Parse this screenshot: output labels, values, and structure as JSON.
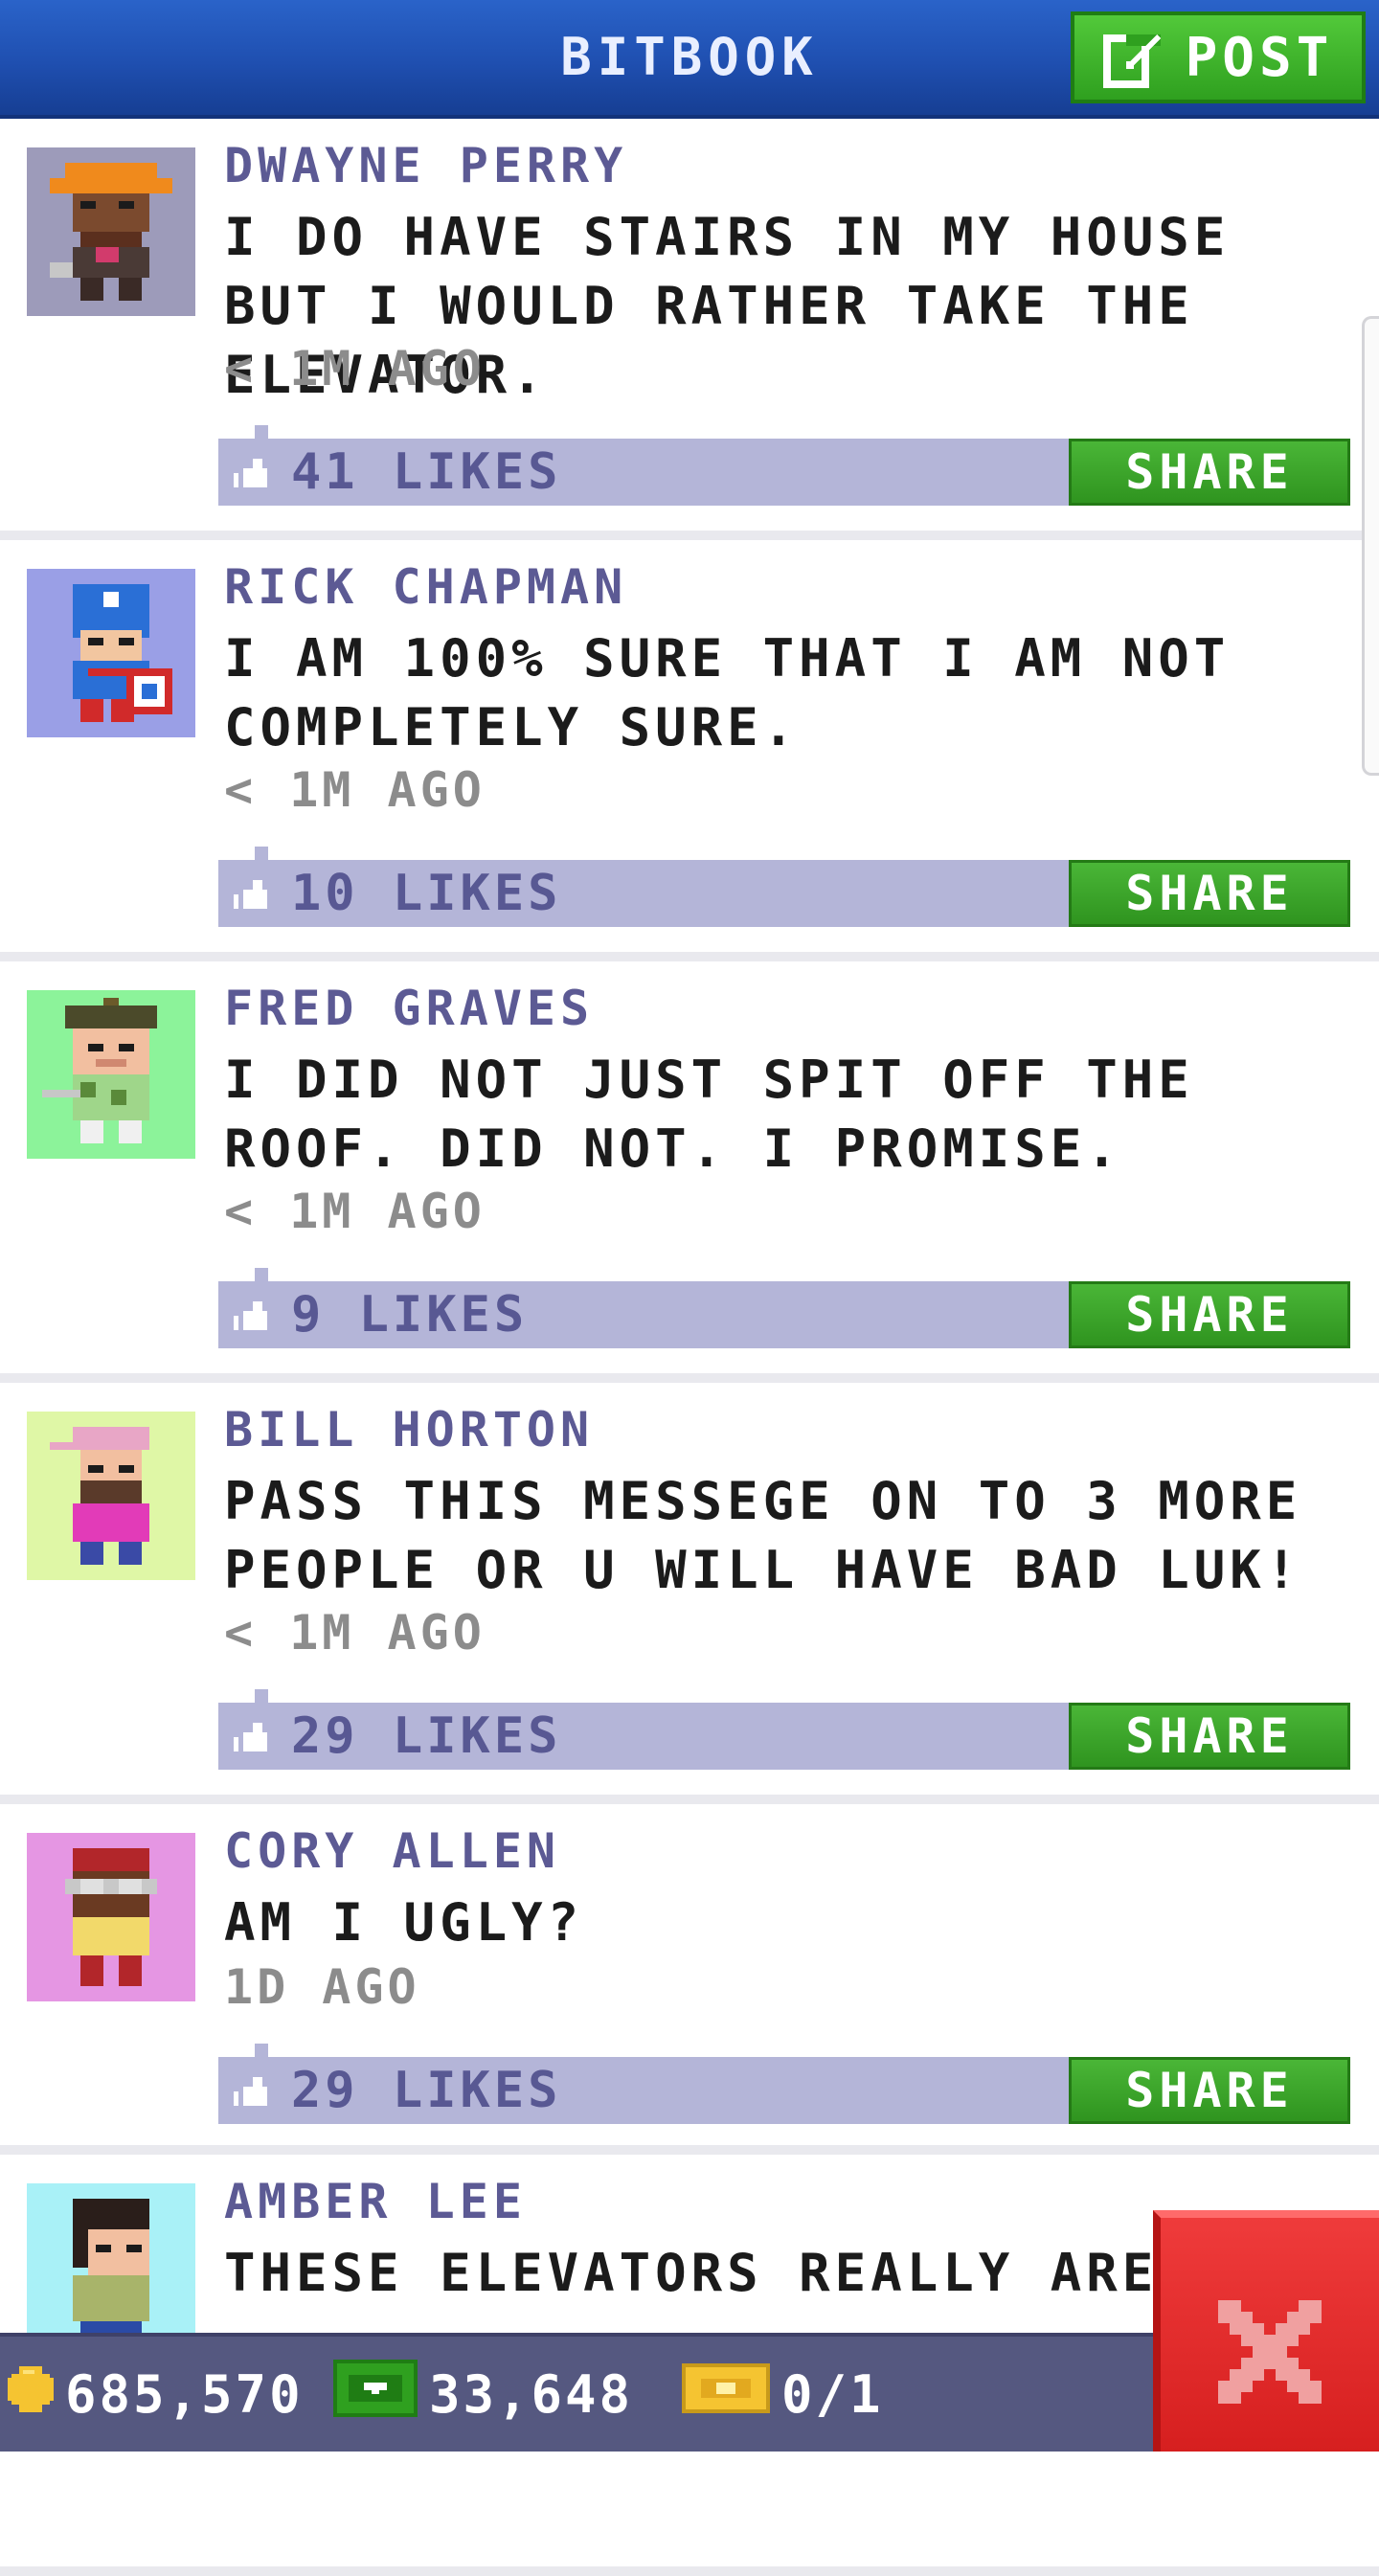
{
  "header": {
    "title": "BITBOOK",
    "post_label": "POST"
  },
  "posts": [
    {
      "author": "DWAYNE PERRY",
      "message": "I DO HAVE STAIRS IN MY HOUSE BUT I WOULD RATHER TAKE THE ELEVATOR.",
      "time": "< 1M AGO",
      "likes": "41 LIKES",
      "share": "SHARE",
      "avatar_bg": "#9d9bba"
    },
    {
      "author": "RICK CHAPMAN",
      "message": "I AM 100% SURE THAT I AM NOT COMPLETELY SURE.",
      "time": "< 1M AGO",
      "likes": "10 LIKES",
      "share": "SHARE",
      "avatar_bg": "#9a9fe6"
    },
    {
      "author": "FRED GRAVES",
      "message": "I DID NOT JUST SPIT OFF THE ROOF. DID NOT. I PROMISE.",
      "time": "< 1M AGO",
      "likes": "9 LIKES",
      "share": "SHARE",
      "avatar_bg": "#8cf39a"
    },
    {
      "author": "BILL HORTON",
      "message": "PASS THIS MESSEGE ON TO 3 MORE PEOPLE OR U WILL HAVE BAD LUK!",
      "time": "< 1M AGO",
      "likes": "29 LIKES",
      "share": "SHARE",
      "avatar_bg": "#dff7a6"
    },
    {
      "author": "CORY ALLEN",
      "message": "AM I UGLY?",
      "time": "1D AGO",
      "likes": "29 LIKES",
      "share": "SHARE",
      "avatar_bg": "#e596e3"
    },
    {
      "author": "AMBER LEE",
      "message": "THESE ELEVATORS REALLY AREN",
      "time": "",
      "likes": "",
      "share": "",
      "avatar_bg": "#a9f1f7"
    }
  ],
  "status": {
    "coins": "685,570",
    "bux": "33,648",
    "tickets": "0/1"
  },
  "colors": {
    "header_blue": "#1f4fb0",
    "post_green": "#3fb52b",
    "like_bar": "#b4b5d8",
    "author_purple": "#5c5a94",
    "close_red": "#e02a2a",
    "status_bar": "#555880"
  },
  "icons": {
    "post": "edit-icon",
    "like": "thumbs-up-icon",
    "coins": "coin-icon",
    "bux": "bux-icon",
    "tickets": "ticket-icon",
    "close": "close-icon"
  }
}
